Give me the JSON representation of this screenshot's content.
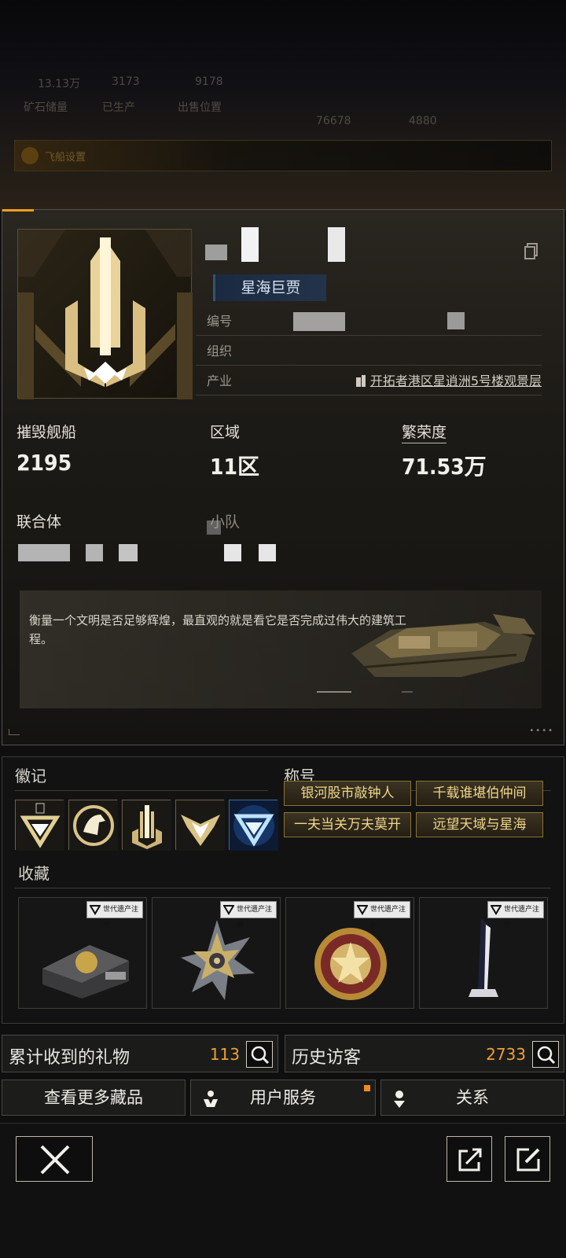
{
  "background": {
    "strip_label": "飞船设置",
    "blur_items": [
      "13.13万",
      "3173",
      "9178",
      "矿石储量",
      "已生产",
      "出售位置",
      "76678",
      "4880"
    ]
  },
  "profile": {
    "title_tag": "星海巨贾",
    "rows": {
      "number_label": "编号",
      "org_label": "组织",
      "industry_label": "产业",
      "industry_value": "开拓者港区星逍洲5号楼观景层"
    },
    "stats": {
      "ships_label": "摧毁舰船",
      "ships_value": "2195",
      "region_label": "区域",
      "region_value": "11区",
      "prosperity_label": "繁荣度",
      "prosperity_value": "71.53万",
      "union_label": "联合体",
      "squad_label": "小队"
    },
    "description": "衡量一个文明是否足够辉煌，最直观的就是看它是否完成过伟大的建筑工程。"
  },
  "collection": {
    "badges_label": "徽记",
    "titles_label": "称号",
    "collect_label": "收藏",
    "titles": [
      "银河股市敲钟人",
      "千载谁堪伯仲间",
      "一夫当关万夫莫开",
      "远望天域与星海"
    ],
    "item_tag": "世代遗产注册",
    "colors": {
      "accent": "#f0a030",
      "chip_text": "#f0d68a"
    }
  },
  "footer": {
    "gifts_label": "累计收到的礼物",
    "gifts_count": "113",
    "visitors_label": "历史访客",
    "visitors_count": "2733",
    "more_items": "查看更多藏品",
    "user_service": "用户服务",
    "relations": "关系"
  }
}
